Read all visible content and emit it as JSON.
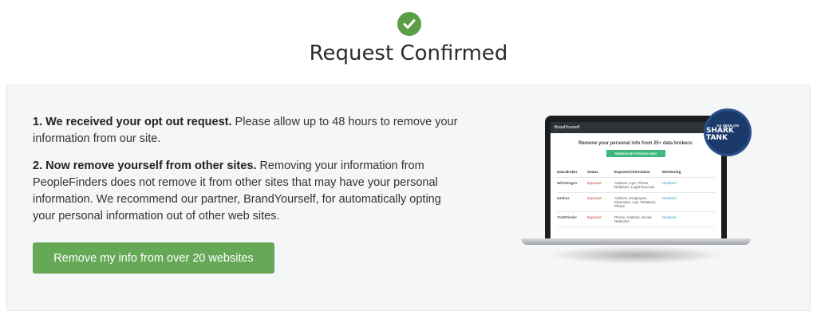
{
  "header": {
    "icon": "check-circle-icon",
    "title": "Request Confirmed"
  },
  "colors": {
    "accent_green": "#65a956",
    "check_green": "#5a9e46",
    "panel_bg": "#f5f6f8"
  },
  "body": {
    "step1_bold": "1. We received your opt out request.",
    "step1_text": " Please allow up to 48 hours to remove your information from our site.",
    "step2_bold": "2. Now remove yourself from other sites.",
    "step2_text": " Removing your information from PeopleFinders does not remove it from other sites that may have your personal information. We recommend our partner, BrandYourself, for automatically opting your personal information out of other web sites.",
    "cta_label": "Remove my info from over 20 websites"
  },
  "promo": {
    "brand": "BrandYourself",
    "headline": "Remove your personal info from 25+ data brokers:",
    "button": "REMOVE MY PRIVATE INFO",
    "badge_small": "AS SEEN ON",
    "badge_big": "SHARK TANK",
    "table": {
      "headers": [
        "Data Broker",
        "Status",
        "Exposed Information",
        "Monitoring"
      ],
      "rows": [
        [
          "WhitePages",
          "Exposed",
          "Address, Age, Phone, Relatives, Legal Records",
          "Disabled"
        ],
        [
          "Intelius",
          "Exposed",
          "Address, Employers, Education, Age, Relatives, Phone",
          "Disabled"
        ],
        [
          "TruthFinder",
          "Exposed",
          "Phone, Address, Social Networks",
          "Disabled"
        ]
      ]
    }
  }
}
